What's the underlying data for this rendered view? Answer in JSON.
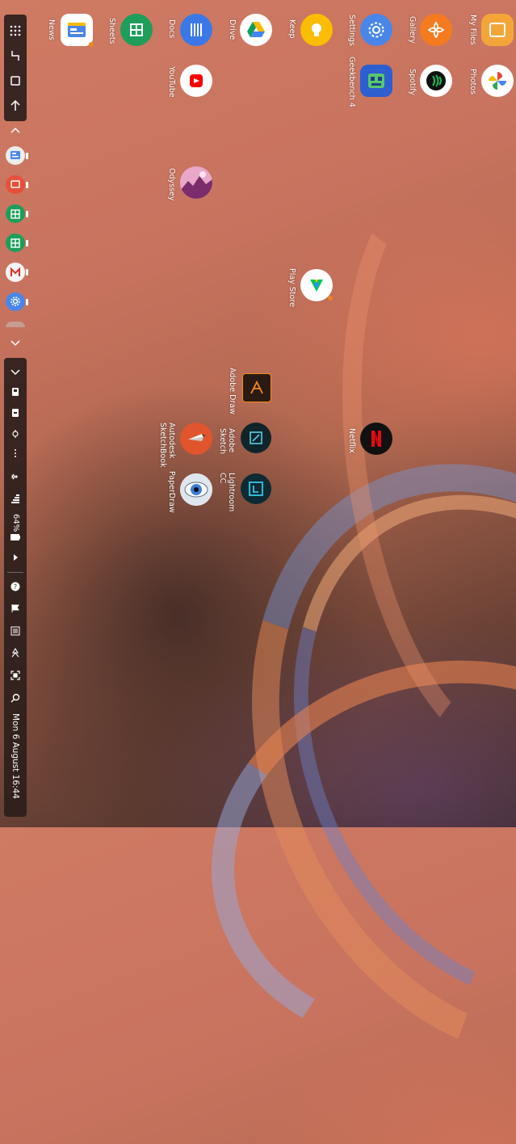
{
  "taskbar": {
    "top_buttons": [
      "apps-grid-icon",
      "recent-apps-icon",
      "home-icon",
      "back-icon"
    ],
    "collapse_up_icon": "chevron-up-icon",
    "collapse_down_icon": "chevron-down-icon",
    "pinned_apps": [
      {
        "name": "news",
        "color": "#e8e8e8"
      },
      {
        "name": "screen-recorder",
        "color": "#e8503b"
      },
      {
        "name": "sheets",
        "color": "#1e9e5a"
      },
      {
        "name": "sheets-2",
        "color": "#1e9e5a"
      },
      {
        "name": "gmail",
        "color": "#f1f1f1"
      },
      {
        "name": "settings",
        "color": "#4a86e8"
      }
    ]
  },
  "tray": {
    "battery": "64%",
    "clock": "Mon 6 August  16:44"
  },
  "apps": [
    {
      "label": "My Files",
      "color": "#f4a53a",
      "icon": "folder-icon"
    },
    {
      "label": "Gallery",
      "color": "#f57b1f",
      "icon": "flower-icon"
    },
    {
      "label": "Settings",
      "color": "#4a86e8",
      "icon": "gear-icon"
    },
    {
      "label": "Keep",
      "color": "#fbbc04",
      "icon": "bulb-icon"
    },
    {
      "label": "Drive",
      "color": "#ffffff",
      "icon": "drive-icon"
    },
    {
      "label": "Docs",
      "color": "#3b78e7",
      "icon": "docs-icon"
    },
    {
      "label": "Sheets",
      "color": "#1e9e5a",
      "icon": "sheets-icon"
    },
    {
      "label": "News",
      "color": "#ffffff",
      "icon": "news-icon"
    },
    {
      "label": "Photos",
      "color": "#ffffff",
      "icon": "pinwheel-icon"
    },
    {
      "label": "Spotify",
      "color": "#ffffff",
      "icon": "spotify-icon"
    },
    {
      "label": "Geekbench 4",
      "color": "#2d5fd0",
      "icon": "geekbench-icon"
    },
    {
      "label": "YouTube",
      "color": "#ffffff",
      "icon": "youtube-icon"
    },
    {
      "label": "Odyssey",
      "color": "#e9a7c9",
      "icon": "odyssey-icon"
    },
    {
      "label": "Play Store",
      "color": "#ffffff",
      "icon": "play-store-icon"
    },
    {
      "label": "Adobe Draw",
      "color": "#2a1a14",
      "icon": "adobe-draw-icon"
    },
    {
      "label": "Adobe\nSketch",
      "color": "#10242a",
      "icon": "adobe-sketch-icon"
    },
    {
      "label": "Autodesk\nSketchBook",
      "color": "#e0552e",
      "icon": "sketchbook-icon"
    },
    {
      "label": "Netflix",
      "color": "#111111",
      "icon": "netflix-icon"
    },
    {
      "label": "Lightroom\nCC",
      "color": "#0e2a33",
      "icon": "lightroom-icon"
    },
    {
      "label": "PaperDraw",
      "color": "#dfe6ee",
      "icon": "paperdraw-icon"
    }
  ]
}
